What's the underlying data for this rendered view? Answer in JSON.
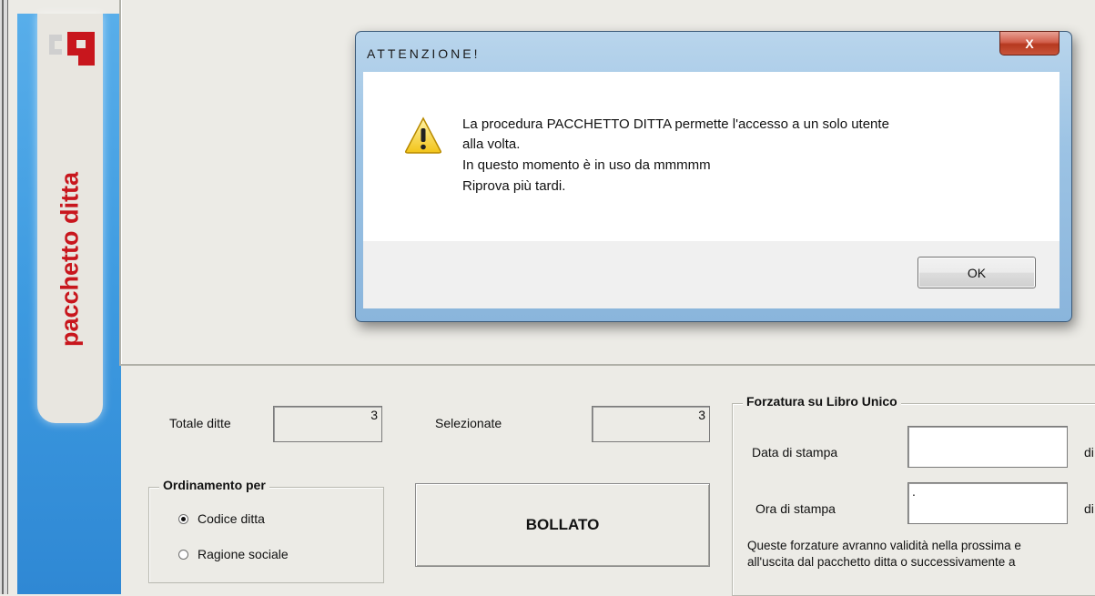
{
  "sidebar": {
    "title": "pacchetto ditta",
    "logo_icon": "cp-logo-icon"
  },
  "counts": {
    "total_label": "Totale ditte",
    "total_value": "3",
    "selected_label": "Selezionate",
    "selected_value": "3"
  },
  "ordering": {
    "title": "Ordinamento per",
    "options": [
      {
        "label": "Codice ditta",
        "selected": true
      },
      {
        "label": "Ragione sociale",
        "selected": false
      }
    ]
  },
  "bollato_label": "BOLLATO",
  "forzatura": {
    "title": "Forzatura su Libro Unico",
    "date_label": "Data di stampa",
    "date_value": "",
    "date_suffix": "di",
    "time_label": "Ora di stampa",
    "time_value": ".",
    "time_suffix": "di",
    "note_lines": [
      "Queste forzature avranno validità nella prossima e",
      "all'uscita dal pacchetto ditta o successivamente a"
    ]
  },
  "dialog": {
    "title": "ATTENZIONE!",
    "close_label": "X",
    "icon": "warning-icon",
    "message_lines": [
      "La procedura PACCHETTO DITTA permette l'accesso a un solo utente",
      "alla volta.",
      "In questo momento è in uso da mmmmm",
      "Riprova più tardi."
    ],
    "ok_label": "OK"
  },
  "colors": {
    "sidebar_blue": "#3d9ae0",
    "brand_red": "#c8161d",
    "dialog_frame": "#9cc3e4"
  }
}
